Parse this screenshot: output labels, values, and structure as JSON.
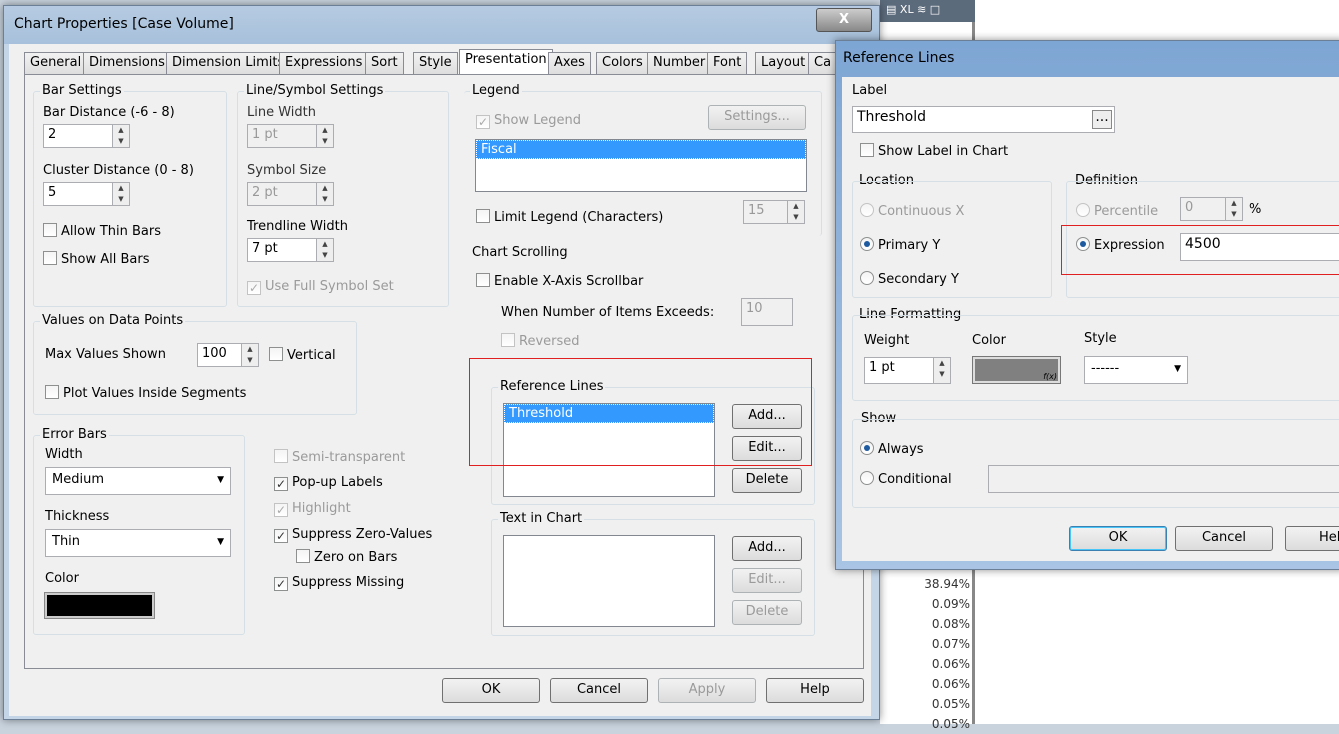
{
  "background": {
    "percentages": [
      "38.94%",
      "0.09%",
      "0.08%",
      "0.07%",
      "0.06%",
      "0.06%",
      "0.05%",
      "0.05%"
    ],
    "toolbar_icons": [
      "print-icon",
      "xl-icon",
      "chart-icon",
      "maximize-icon"
    ],
    "xl_label": "XL"
  },
  "chart_props": {
    "title": "Chart Properties [Case Volume]",
    "tabs": [
      "General",
      "Dimensions",
      "Dimension Limits",
      "Expressions",
      "Sort",
      "Style",
      "Presentation",
      "Axes",
      "Colors",
      "Number",
      "Font",
      "Layout",
      "Ca"
    ],
    "active_tab": "Presentation",
    "bar_settings": {
      "title": "Bar Settings",
      "bar_distance_label": "Bar Distance (-6 - 8)",
      "bar_distance": "2",
      "cluster_distance_label": "Cluster Distance (0 - 8)",
      "cluster_distance": "5",
      "allow_thin_bars": "Allow Thin Bars",
      "show_all_bars": "Show All Bars"
    },
    "line_symbol": {
      "title": "Line/Symbol Settings",
      "line_width_label": "Line Width",
      "line_width": "1 pt",
      "symbol_size_label": "Symbol Size",
      "symbol_size": "2 pt",
      "trendline_width_label": "Trendline Width",
      "trendline_width": "7 pt",
      "use_full_symbol_set": "Use Full Symbol Set"
    },
    "values_on_points": {
      "title": "Values on Data Points",
      "max_values_label": "Max Values Shown",
      "max_values": "100",
      "vertical": "Vertical",
      "plot_inside": "Plot Values Inside Segments"
    },
    "error_bars": {
      "title": "Error Bars",
      "width_label": "Width",
      "width": "Medium",
      "thickness_label": "Thickness",
      "thickness": "Thin",
      "color_label": "Color",
      "color": "#000000"
    },
    "misc": {
      "semi_transparent": "Semi-transparent",
      "popup_labels": "Pop-up Labels",
      "highlight": "Highlight",
      "suppress_zero": "Suppress Zero-Values",
      "zero_on_bars": "Zero on Bars",
      "suppress_missing": "Suppress Missing"
    },
    "legend": {
      "title": "Legend",
      "show_legend": "Show Legend",
      "settings": "Settings...",
      "items": [
        "Fiscal"
      ],
      "limit_legend": "Limit Legend (Characters)",
      "limit_value": "15"
    },
    "scrolling": {
      "title": "Chart Scrolling",
      "enable": "Enable X-Axis Scrollbar",
      "when_exceeds": "When Number of Items Exceeds:",
      "exceeds_value": "10",
      "reversed": "Reversed"
    },
    "reference_lines": {
      "title": "Reference Lines",
      "items": [
        "Threshold"
      ],
      "add": "Add...",
      "edit": "Edit...",
      "delete": "Delete"
    },
    "text_in_chart": {
      "title": "Text in Chart",
      "add": "Add...",
      "edit": "Edit...",
      "delete": "Delete"
    },
    "buttons": {
      "ok": "OK",
      "cancel": "Cancel",
      "apply": "Apply",
      "help": "Help"
    }
  },
  "ref_dialog": {
    "title": "Reference Lines",
    "label_title": "Label",
    "label_value": "Threshold",
    "browse": "...",
    "show_label": "Show Label in Chart",
    "location": {
      "title": "Location",
      "continuous_x": "Continuous X",
      "primary_y": "Primary Y",
      "secondary_y": "Secondary Y"
    },
    "definition": {
      "title": "Definition",
      "percentile": "Percentile",
      "percentile_value": "0",
      "percent_sign": "%",
      "expression": "Expression",
      "expression_value": "4500"
    },
    "line_formatting": {
      "title": "Line Formatting",
      "weight_label": "Weight",
      "weight": "1 pt",
      "color_label": "Color",
      "color": "#808080",
      "fx": "f(x)",
      "style_label": "Style",
      "style": "------"
    },
    "show": {
      "title": "Show",
      "always": "Always",
      "conditional": "Conditional"
    },
    "buttons": {
      "ok": "OK",
      "cancel": "Cancel",
      "help": "Help"
    },
    "highlight_color": "#e02020"
  }
}
